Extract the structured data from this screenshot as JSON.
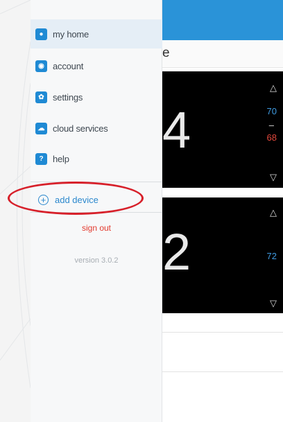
{
  "drawer": {
    "items": [
      {
        "label": "my home",
        "icon": "location-pin-icon",
        "glyph": "●"
      },
      {
        "label": "account",
        "icon": "user-icon",
        "glyph": "◉"
      },
      {
        "label": "settings",
        "icon": "gear-icon",
        "glyph": "✿"
      },
      {
        "label": "cloud services",
        "icon": "cloud-icon",
        "glyph": "☁"
      },
      {
        "label": "help",
        "icon": "help-icon",
        "glyph": "?"
      }
    ],
    "add_device": "add device",
    "sign_out": "sign out",
    "version": "version 3.0.2"
  },
  "app": {
    "title_fragment": "e",
    "thermostats": [
      {
        "temp": "4",
        "cool_setpoint": "70",
        "separator": "–",
        "heat_setpoint": "68"
      },
      {
        "temp": "2",
        "setpoint": "72"
      }
    ]
  },
  "colors": {
    "accent": "#2a93d8",
    "sign_out": "#e33a2e",
    "highlight_oval": "#d7202a"
  }
}
